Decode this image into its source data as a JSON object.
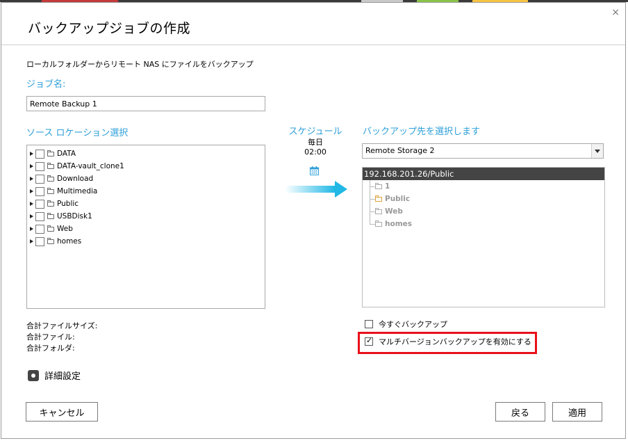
{
  "dialog": {
    "title": "バックアップジョブの作成",
    "subtitle": "ローカルフォルダーからリモート NAS にファイルをバックアップ"
  },
  "job": {
    "label": "ジョブ名:",
    "value": "Remote Backup 1"
  },
  "source": {
    "label": "ソース ロケーション選択",
    "folders": [
      "DATA",
      "DATA-vault_clone1",
      "Download",
      "Multimedia",
      "Public",
      "USBDisk1",
      "Web",
      "homes"
    ]
  },
  "schedule": {
    "label": "スケジュール",
    "frequency": "毎日",
    "time": "02:00",
    "icon": "calendar-icon"
  },
  "destination": {
    "label": "バックアップ先を選択します",
    "selected_storage": "Remote Storage 2",
    "root": "192.168.201.26/Public",
    "folders": [
      "1",
      "Public",
      "Web",
      "homes"
    ]
  },
  "totals": {
    "size_label": "合計ファイルサイズ:",
    "files_label": "合計ファイル:",
    "folders_label": "合計フォルダ:"
  },
  "options": {
    "backup_now": "今すぐバックアップ",
    "multi_version": "マルチバージョンバックアップを有効にする"
  },
  "advanced": {
    "label": "詳細設定"
  },
  "buttons": {
    "cancel": "キャンセル",
    "back": "戻る",
    "apply": "適用",
    "close": "×"
  },
  "colors": {
    "accent": "#2d9fd9",
    "highlight": "#e8101a"
  }
}
